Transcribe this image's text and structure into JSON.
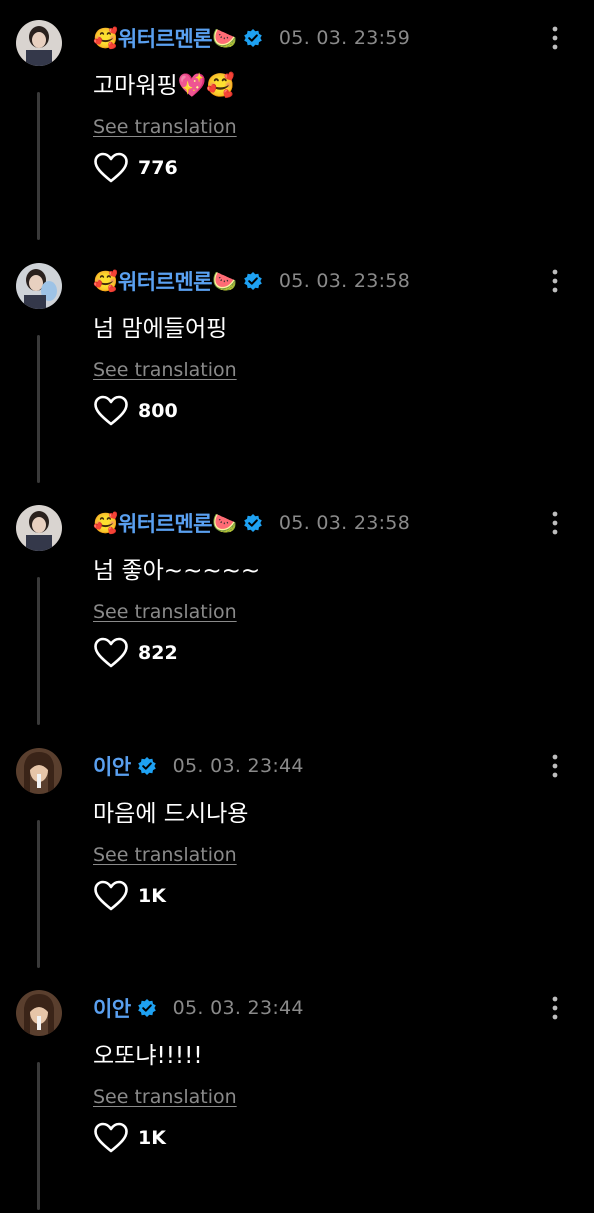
{
  "translate_label": "See translation",
  "colors": {
    "username": "#5aa0f0",
    "verified": "#1ea1f2",
    "meta": "#8a8a8a",
    "background": "#000000"
  },
  "comments": [
    {
      "username": "워터르멘론",
      "emoji_before": "🥰",
      "emoji_after": "🍉",
      "verified": true,
      "time": "05. 03. 23:59",
      "message": "고마워핑💖🥰",
      "likes": "776",
      "avatar": "user-photo-avatar"
    },
    {
      "username": "워터르멘론",
      "emoji_before": "🥰",
      "emoji_after": "🍉",
      "verified": true,
      "time": "05. 03. 23:58",
      "message": "넘 맘에들어핑",
      "likes": "800",
      "avatar": "user-photo-avatar"
    },
    {
      "username": "워터르멘론",
      "emoji_before": "🥰",
      "emoji_after": "🍉",
      "verified": true,
      "time": "05. 03. 23:58",
      "message": "넘 좋아~~~~~",
      "likes": "822",
      "avatar": "user-photo-avatar"
    },
    {
      "username": "이안",
      "emoji_before": "",
      "emoji_after": "",
      "verified": true,
      "time": "05. 03. 23:44",
      "message": "마음에 드시나용",
      "likes": "1K",
      "avatar": "user-photo-avatar"
    },
    {
      "username": "이안",
      "emoji_before": "",
      "emoji_after": "",
      "verified": true,
      "time": "05. 03. 23:44",
      "message": "오또냐!!!!!",
      "likes": "1K",
      "avatar": "user-photo-avatar"
    }
  ]
}
